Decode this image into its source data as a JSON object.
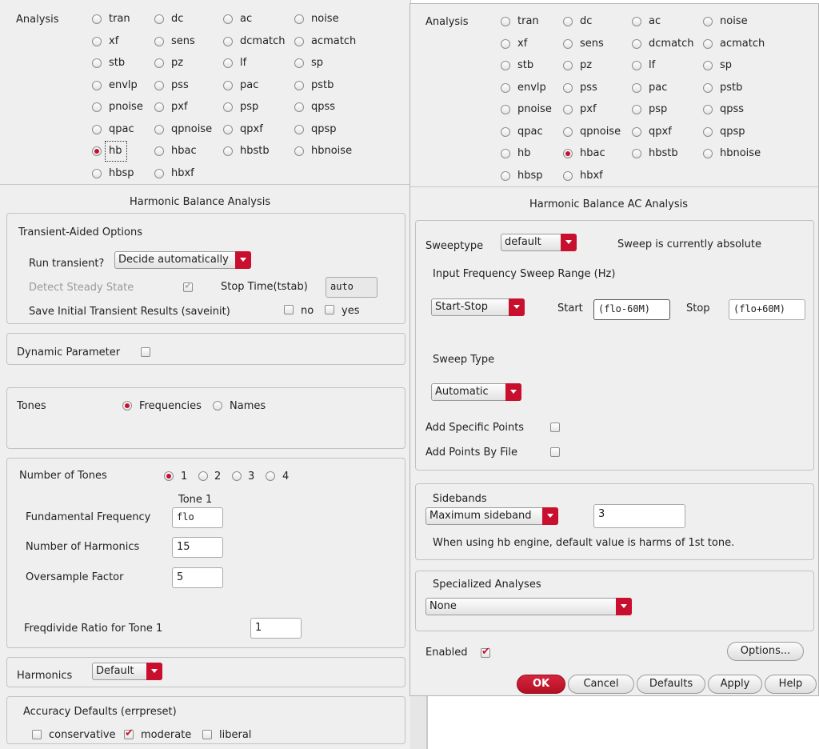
{
  "left": {
    "analysis_label": "Analysis",
    "analyses": [
      [
        "tran",
        "dc",
        "ac",
        "noise"
      ],
      [
        "xf",
        "sens",
        "dcmatch",
        "acmatch"
      ],
      [
        "stb",
        "pz",
        "lf",
        "sp"
      ],
      [
        "envlp",
        "pss",
        "pac",
        "pstb"
      ],
      [
        "pnoise",
        "pxf",
        "psp",
        "qpss"
      ],
      [
        "qpac",
        "qpnoise",
        "qpxf",
        "qpsp"
      ],
      [
        "hb",
        "hbac",
        "hbstb",
        "hbnoise"
      ],
      [
        "hbsp",
        "hbxf"
      ]
    ],
    "selected_analysis": "hb",
    "section_title": "Harmonic Balance Analysis",
    "transient": {
      "title": "Transient-Aided Options",
      "run_label": "Run transient?",
      "run_value": "Decide automatically",
      "detect_label": "Detect Steady State",
      "stop_label": "Stop Time(tstab)",
      "stop_value": "auto",
      "saveinit_label": "Save Initial Transient Results (saveinit)",
      "no_label": "no",
      "yes_label": "yes"
    },
    "dynamic_param_label": "Dynamic Parameter",
    "tones": {
      "label": "Tones",
      "frequencies_label": "Frequencies",
      "names_label": "Names",
      "selected": "Frequencies"
    },
    "num_tones": {
      "label": "Number of Tones",
      "options": [
        "1",
        "2",
        "3",
        "4"
      ],
      "selected": "1",
      "tone_col_header": "Tone 1",
      "fund_freq_label": "Fundamental Frequency",
      "fund_freq_value": "flo",
      "num_harm_label": "Number of Harmonics",
      "num_harm_value": "15",
      "oversample_label": "Oversample Factor",
      "oversample_value": "5",
      "freqdivide_label": "Freqdivide Ratio for Tone 1",
      "freqdivide_value": "1"
    },
    "harmonics": {
      "label": "Harmonics",
      "value": "Default"
    },
    "accuracy": {
      "title": "Accuracy Defaults (errpreset)",
      "conservative": "conservative",
      "moderate": "moderate",
      "liberal": "liberal",
      "selected": "moderate"
    }
  },
  "right": {
    "analysis_label": "Analysis",
    "analyses": [
      [
        "tran",
        "dc",
        "ac",
        "noise"
      ],
      [
        "xf",
        "sens",
        "dcmatch",
        "acmatch"
      ],
      [
        "stb",
        "pz",
        "lf",
        "sp"
      ],
      [
        "envlp",
        "pss",
        "pac",
        "pstb"
      ],
      [
        "pnoise",
        "pxf",
        "psp",
        "qpss"
      ],
      [
        "qpac",
        "qpnoise",
        "qpxf",
        "qpsp"
      ],
      [
        "hb",
        "hbac",
        "hbstb",
        "hbnoise"
      ],
      [
        "hbsp",
        "hbxf"
      ]
    ],
    "selected_analysis": "hbac",
    "section_title": "Harmonic Balance AC Analysis",
    "sweeptype_label": "Sweeptype",
    "sweeptype_value": "default",
    "sweep_status": "Sweep is currently absolute",
    "range_label": "Input Frequency Sweep Range (Hz)",
    "range_mode": "Start-Stop",
    "start_label": "Start",
    "start_value": "(flo-60M)",
    "stop_label": "Stop",
    "stop_value": "(flo+60M)",
    "sweep_type_label": "Sweep Type",
    "sweep_type_value": "Automatic",
    "add_points_label": "Add Specific Points",
    "add_file_label": "Add Points By File",
    "sidebands_label": "Sidebands",
    "sidebands_mode": "Maximum sideband",
    "sidebands_value": "3",
    "sidebands_note": "When using hb engine, default value is harms of 1st tone.",
    "specialized_label": "Specialized Analyses",
    "specialized_value": "None",
    "enabled_label": "Enabled",
    "options_button": "Options...",
    "buttons": {
      "ok": "OK",
      "cancel": "Cancel",
      "defaults": "Defaults",
      "apply": "Apply",
      "help": "Help"
    }
  }
}
